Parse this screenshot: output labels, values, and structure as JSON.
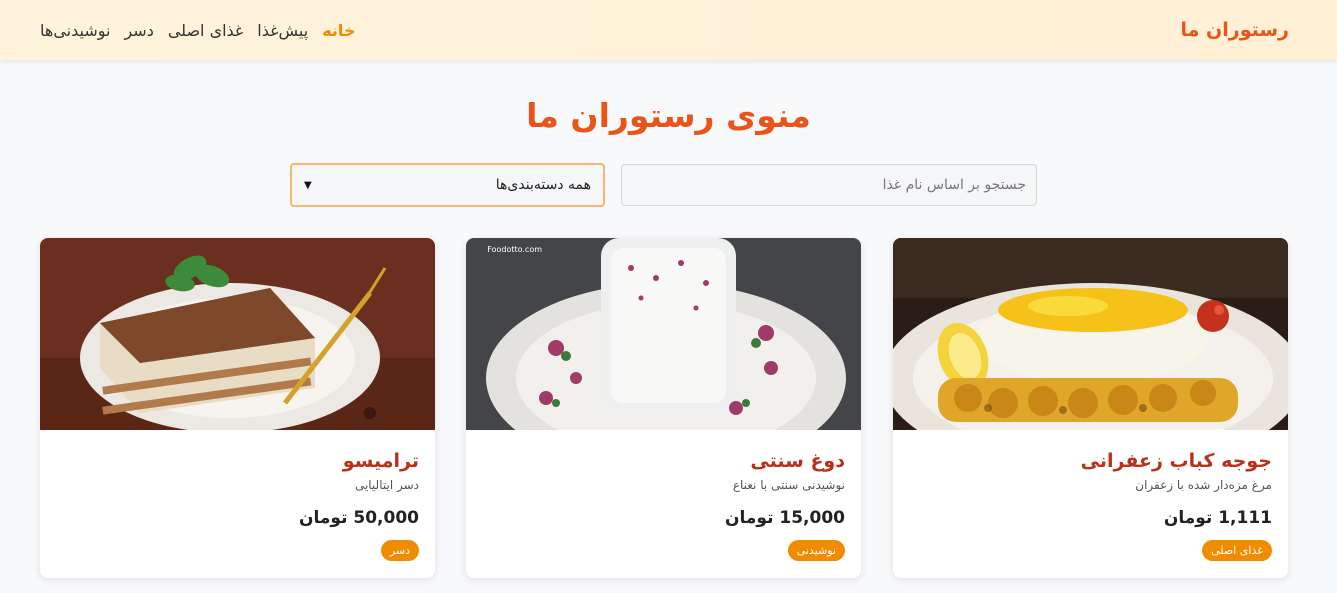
{
  "navbar": {
    "brand": "رستوران ما",
    "links": [
      {
        "label": "خانه",
        "active": true
      },
      {
        "label": "پیش‌غذا",
        "active": false
      },
      {
        "label": "غذای اصلی",
        "active": false
      },
      {
        "label": "دسر",
        "active": false
      },
      {
        "label": "نوشیدنی‌ها",
        "active": false
      }
    ]
  },
  "page_title": "منوی رستوران ما",
  "filters": {
    "search_placeholder": "جستجو بر اساس نام غذا",
    "category_selected": "همه دسته‌بندی‌ها"
  },
  "cards": [
    {
      "title": "جوجه کباب زعفرانی",
      "description": "مرغ مزه‌دار شده با زعفران",
      "price": "1,111 تومان",
      "category": "غذای اصلی"
    },
    {
      "title": "دوغ سنتی",
      "description": "نوشیدنی سنتی با نعناع",
      "price": "15,000 تومان",
      "category": "نوشیدنی",
      "watermark": "Foodotto.com"
    },
    {
      "title": "ترامیسو",
      "description": "دسر ایتالیایی",
      "price": "50,000 تومان",
      "category": "دسر"
    }
  ],
  "colors": {
    "brand": "#e8541a",
    "active_nav": "#f08c00",
    "card_title": "#b8321a",
    "badge": "#f08c00"
  }
}
